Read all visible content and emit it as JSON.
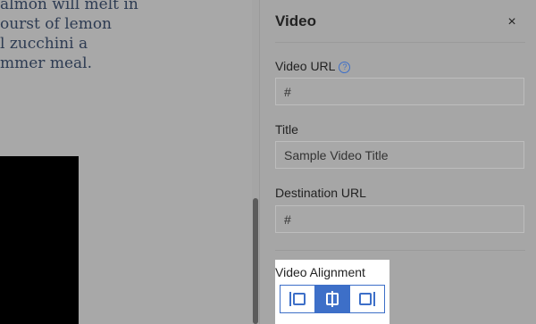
{
  "editor": {
    "body_lines": [
      "almon will melt in",
      "ourst of lemon",
      "l zucchini a",
      "mmer meal."
    ]
  },
  "panel": {
    "title": "Video",
    "close_glyph": "×",
    "video_url": {
      "label": "Video URL",
      "help_glyph": "?",
      "value": "#"
    },
    "title_field": {
      "label": "Title",
      "value": "Sample Video Title"
    },
    "destination_url": {
      "label": "Destination URL",
      "value": "#"
    },
    "alignment": {
      "label": "Video Alignment",
      "options": [
        "align-left",
        "align-center",
        "align-right"
      ],
      "selected": "align-center"
    }
  },
  "colors": {
    "accent": "#3d6fc8",
    "overlay": "#a6a6a6"
  }
}
